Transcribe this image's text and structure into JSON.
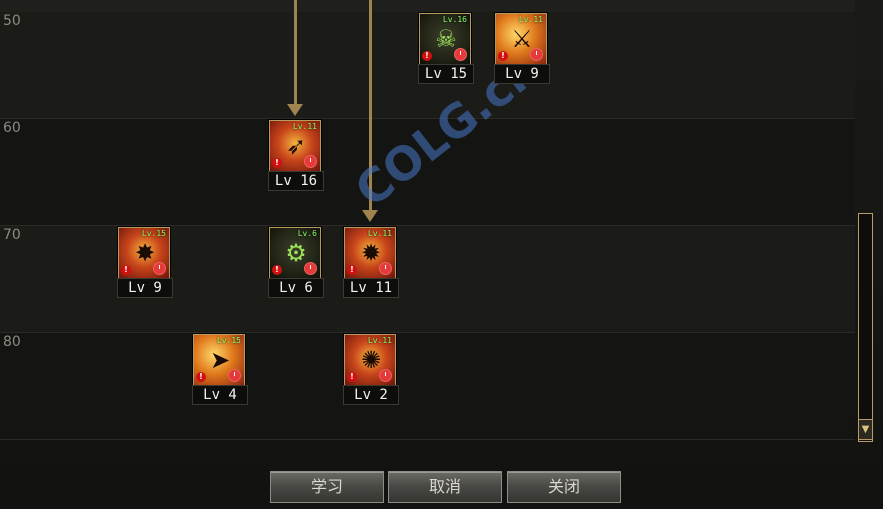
{
  "level_rows": [
    {
      "label": "50"
    },
    {
      "label": "60"
    },
    {
      "label": "70"
    },
    {
      "label": "80"
    }
  ],
  "skills": [
    {
      "name": "skill-lv15",
      "level_label": "Lv 15",
      "mini": "Lv.16",
      "icon": "skull-icon",
      "style": "dark"
    },
    {
      "name": "skill-lv9-top",
      "level_label": "Lv 9",
      "mini": "Lv.11",
      "icon": "blade-icon",
      "style": "orange"
    },
    {
      "name": "skill-lv16",
      "level_label": "Lv 16",
      "mini": "Lv.11",
      "icon": "crossbow-icon",
      "style": "normal"
    },
    {
      "name": "skill-lv9-left",
      "level_label": "Lv 9",
      "mini": "Lv.15",
      "icon": "burst-icon",
      "style": "normal"
    },
    {
      "name": "skill-lv6",
      "level_label": "Lv 6",
      "mini": "Lv.6",
      "icon": "robot-icon",
      "style": "dark"
    },
    {
      "name": "skill-lv11",
      "level_label": "Lv 11",
      "mini": "Lv.11",
      "icon": "cannon-icon",
      "style": "normal"
    },
    {
      "name": "skill-lv4",
      "level_label": "Lv 4",
      "mini": "Lv.15",
      "icon": "rocket-icon",
      "style": "orange"
    },
    {
      "name": "skill-lv2",
      "level_label": "Lv 2",
      "mini": "Lv.11",
      "icon": "explosion-icon",
      "style": "normal"
    }
  ],
  "buttons": {
    "learn": "学习",
    "cancel": "取消",
    "close": "关闭"
  },
  "watermark": "COLG.cn",
  "colors": {
    "arrow": "#a0844f",
    "frame_gold": "#b89b5e",
    "scrollbar_border": "#b79d63"
  }
}
